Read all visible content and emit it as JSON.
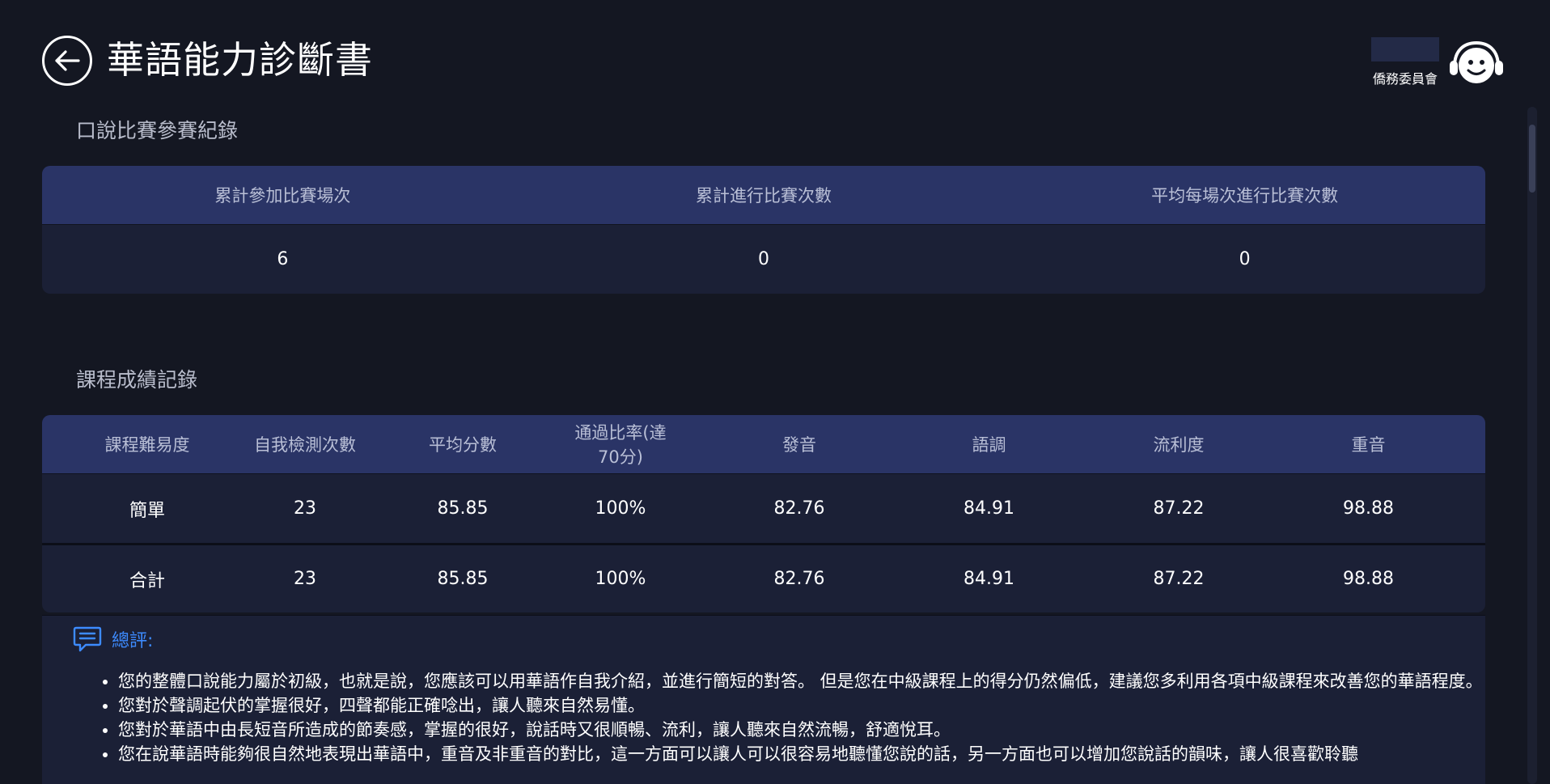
{
  "header": {
    "title": "華語能力診斷書",
    "org_name": "僑務委員會"
  },
  "competition": {
    "section_title": "口說比賽參賽紀錄",
    "headers": [
      "累計參加比賽場次",
      "累計進行比賽次數",
      "平均每場次進行比賽次數"
    ],
    "values": [
      "6",
      "0",
      "0"
    ]
  },
  "course": {
    "section_title": "課程成績記錄",
    "headers": [
      "課程難易度",
      "自我檢測次數",
      "平均分數",
      "通過比率(達70分)",
      "發音",
      "語調",
      "流利度",
      "重音"
    ],
    "rows": [
      [
        "簡單",
        "23",
        "85.85",
        "100%",
        "82.76",
        "84.91",
        "87.22",
        "98.88"
      ],
      [
        "合計",
        "23",
        "85.85",
        "100%",
        "82.76",
        "84.91",
        "87.22",
        "98.88"
      ]
    ]
  },
  "review": {
    "label": "總評:",
    "items": [
      "您的整體口說能力屬於初級，也就是說，您應該可以用華語作自我介紹，並進行簡短的對答。 但是您在中級課程上的得分仍然偏低，建議您多利用各項中級課程來改善您的華語程度。",
      "您對於聲調起伏的掌握很好，四聲都能正確唸出，讓人聽來自然易懂。",
      "您對於華語中由長短音所造成的節奏感，掌握的很好，說話時又很順暢、流利，讓人聽來自然流暢，舒適悅耳。",
      "您在說華語時能夠很自然地表現出華語中，重音及非重音的對比，這一方面可以讓人可以很容易地聽懂您說的話，另一方面也可以增加您說話的韻味，讓人很喜歡聆聽"
    ]
  },
  "icons": {
    "back": "back-arrow-icon",
    "support": "customer-service-icon",
    "comment": "comment-icon"
  },
  "colors": {
    "background": "#141722",
    "table_header": "#2a3466",
    "table_body": "#1b2036",
    "accent": "#3d8bff"
  }
}
